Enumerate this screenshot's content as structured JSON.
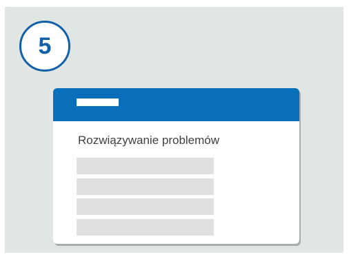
{
  "step": {
    "number": "5"
  },
  "card": {
    "title": "Rozwiązywanie problemów"
  },
  "colors": {
    "background": "#dfe6e4",
    "accent": "#0a6fba",
    "circle_border": "#1160a8",
    "placeholder": "#e0e0e0",
    "text": "#404040"
  }
}
